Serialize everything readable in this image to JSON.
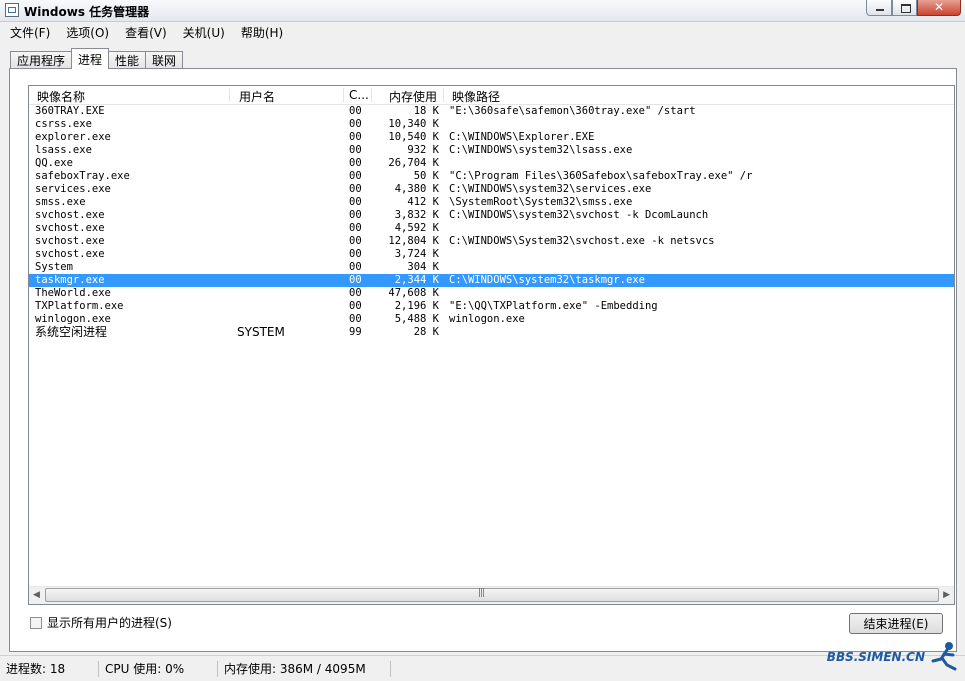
{
  "window": {
    "title": "Windows 任务管理器"
  },
  "menu": [
    "文件(F)",
    "选项(O)",
    "查看(V)",
    "关机(U)",
    "帮助(H)"
  ],
  "tabs": [
    {
      "label": "应用程序",
      "active": false
    },
    {
      "label": "进程",
      "active": true
    },
    {
      "label": "性能",
      "active": false
    },
    {
      "label": "联网",
      "active": false
    }
  ],
  "columns": {
    "name": "映像名称",
    "user": "用户名",
    "cpu": "C...",
    "mem": "内存使用",
    "path": "映像路径"
  },
  "processes": [
    {
      "name": "360TRAY.EXE",
      "user": "",
      "cpu": "00",
      "mem": "18 K",
      "path": "\"E:\\360safe\\safemon\\360tray.exe\" /start"
    },
    {
      "name": "csrss.exe",
      "user": "",
      "cpu": "00",
      "mem": "10,340 K",
      "path": ""
    },
    {
      "name": "explorer.exe",
      "user": "",
      "cpu": "00",
      "mem": "10,540 K",
      "path": "C:\\WINDOWS\\Explorer.EXE"
    },
    {
      "name": "lsass.exe",
      "user": "",
      "cpu": "00",
      "mem": "932 K",
      "path": "C:\\WINDOWS\\system32\\lsass.exe"
    },
    {
      "name": "QQ.exe",
      "user": "",
      "cpu": "00",
      "mem": "26,704 K",
      "path": ""
    },
    {
      "name": "safeboxTray.exe",
      "user": "",
      "cpu": "00",
      "mem": "50 K",
      "path": "\"C:\\Program Files\\360Safebox\\safeboxTray.exe\" /r"
    },
    {
      "name": "services.exe",
      "user": "",
      "cpu": "00",
      "mem": "4,380 K",
      "path": "C:\\WINDOWS\\system32\\services.exe"
    },
    {
      "name": "smss.exe",
      "user": "",
      "cpu": "00",
      "mem": "412 K",
      "path": "\\SystemRoot\\System32\\smss.exe"
    },
    {
      "name": "svchost.exe",
      "user": "",
      "cpu": "00",
      "mem": "3,832 K",
      "path": "C:\\WINDOWS\\system32\\svchost -k DcomLaunch"
    },
    {
      "name": "svchost.exe",
      "user": "",
      "cpu": "00",
      "mem": "4,592 K",
      "path": ""
    },
    {
      "name": "svchost.exe",
      "user": "",
      "cpu": "00",
      "mem": "12,804 K",
      "path": "C:\\WINDOWS\\System32\\svchost.exe -k netsvcs"
    },
    {
      "name": "svchost.exe",
      "user": "",
      "cpu": "00",
      "mem": "3,724 K",
      "path": ""
    },
    {
      "name": "System",
      "user": "",
      "cpu": "00",
      "mem": "304 K",
      "path": ""
    },
    {
      "name": "taskmgr.exe",
      "user": "",
      "cpu": "00",
      "mem": "2,344 K",
      "path": "C:\\WINDOWS\\system32\\taskmgr.exe",
      "selected": true
    },
    {
      "name": "TheWorld.exe",
      "user": "",
      "cpu": "00",
      "mem": "47,608 K",
      "path": ""
    },
    {
      "name": "TXPlatform.exe",
      "user": "",
      "cpu": "00",
      "mem": "2,196 K",
      "path": "\"E:\\QQ\\TXPlatform.exe\" -Embedding"
    },
    {
      "name": "winlogon.exe",
      "user": "",
      "cpu": "00",
      "mem": "5,488 K",
      "path": "winlogon.exe"
    },
    {
      "name": "系统空闲进程",
      "user": "SYSTEM",
      "cpu": "99",
      "mem": "28 K",
      "path": "",
      "cjk": true
    }
  ],
  "show_all_users_label": "显示所有用户的进程(S)",
  "end_process_label": "结束进程(E)",
  "status": {
    "processes": "进程数: 18",
    "cpu": "CPU 使用: 0%",
    "memory": "内存使用: 386M / 4095M"
  },
  "watermark": "BBS.SIMEN.CN",
  "colors": {
    "selection": "#3399ff",
    "close_button": "#c8452e"
  }
}
